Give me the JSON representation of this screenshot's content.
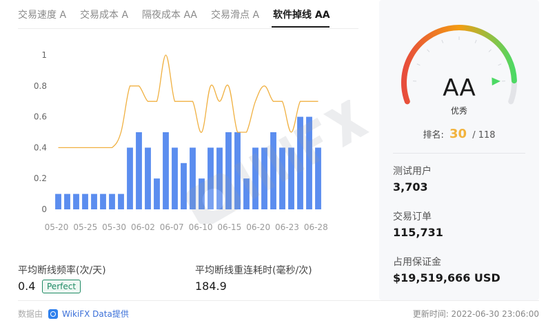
{
  "tabs": [
    {
      "label": "交易速度 A",
      "active": false
    },
    {
      "label": "交易成本 A",
      "active": false
    },
    {
      "label": "隔夜成本 AA",
      "active": false
    },
    {
      "label": "交易滑点 A",
      "active": false
    },
    {
      "label": "软件掉线 AA",
      "active": true
    }
  ],
  "chart_data": {
    "type": "bar",
    "y_ticks": [
      "1",
      "0.8",
      "0.6",
      "0.4",
      "0.2",
      "0"
    ],
    "ylim": [
      0,
      1
    ],
    "x_ticks": [
      "05-20",
      "05-25",
      "05-30",
      "06-02",
      "06-07",
      "06-10",
      "06-15",
      "06-20",
      "06-23",
      "06-28"
    ],
    "series": [
      {
        "type": "bar",
        "color": "#5b8def",
        "values": [
          0.1,
          0.1,
          0.1,
          0.1,
          0.1,
          0.1,
          0.1,
          0.1,
          0.4,
          0.5,
          0.4,
          0.2,
          0.5,
          0.4,
          0.3,
          0.4,
          0.2,
          0.4,
          0.4,
          0.5,
          0.5,
          0.2,
          0.4,
          0.4,
          0.5,
          0.4,
          0.4,
          0.6,
          0.6,
          0.4
        ]
      },
      {
        "type": "line",
        "color": "#f0b040",
        "values": [
          0.4,
          0.4,
          0.4,
          0.4,
          0.4,
          0.4,
          0.4,
          0.5,
          0.8,
          0.8,
          0.7,
          0.7,
          1.0,
          0.7,
          0.7,
          0.7,
          0.5,
          0.8,
          0.7,
          0.8,
          0.5,
          0.5,
          0.7,
          0.8,
          0.7,
          0.7,
          0.5,
          0.7,
          0.7,
          0.7
        ]
      }
    ],
    "grid": false
  },
  "stats": {
    "freq_label": "平均断线频率(次/天)",
    "freq_value": "0.4",
    "freq_badge": "Perfect",
    "reconnect_label": "平均断线重连耗时(毫秒/次)",
    "reconnect_value": "184.9"
  },
  "footer": {
    "source_prefix": "数据由",
    "source_name": "WikiFX Data提供",
    "update_label": "更新时间: 2022-06-30 23:06:00"
  },
  "panel": {
    "grade": "AA",
    "grade_desc": "优秀",
    "rank_label": "排名:",
    "rank_value": "30",
    "rank_total": "/ 118",
    "gauge_level": 0.9,
    "test_users_label": "测试用户",
    "test_users_value": "3,703",
    "orders_label": "交易订单",
    "orders_value": "115,731",
    "margin_label": "占用保证金",
    "margin_value": "$19,519,666 USD"
  },
  "colors": {
    "bar": "#5b8def",
    "line": "#f0b040",
    "badge": "#1e8a64",
    "rank": "#f2b33d",
    "gauge_start": "#e74c3c",
    "gauge_mid": "#f39c12",
    "gauge_end": "#4cd964"
  }
}
